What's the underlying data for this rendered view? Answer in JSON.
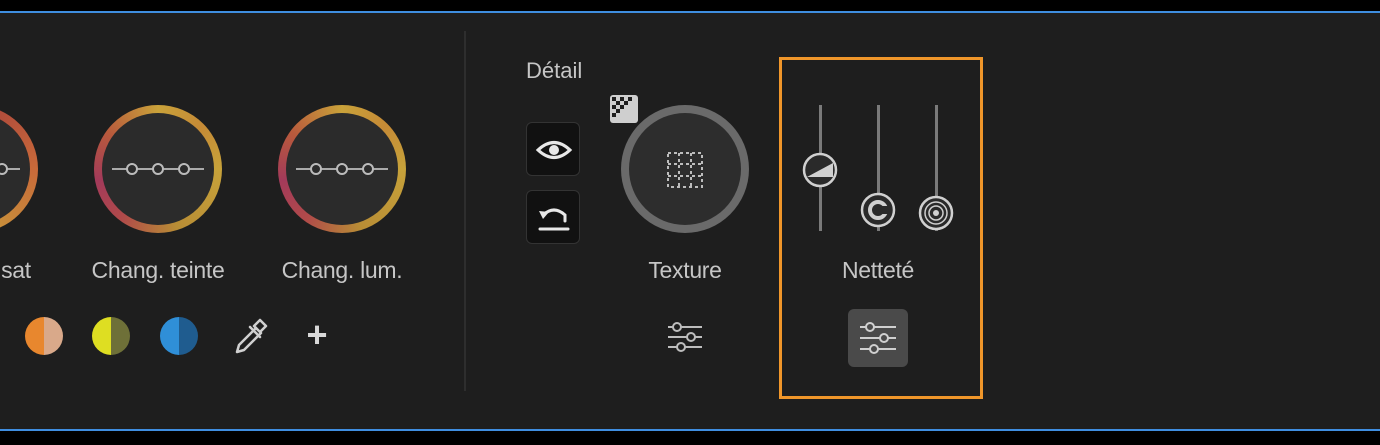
{
  "colors": {
    "accent_border": "#3f8ee0",
    "highlight": "#f0962a",
    "panel_bg": "#1e1e1e"
  },
  "color_section": {
    "wheels": [
      {
        "label": "sat",
        "icon": "saturation-wheel-icon"
      },
      {
        "label": "Chang. teinte",
        "icon": "hue-shift-wheel-icon"
      },
      {
        "label": "Chang. lum.",
        "icon": "luminance-shift-wheel-icon"
      }
    ],
    "swatches": [
      {
        "name": "orange",
        "left": "#e8872e",
        "right": "#d9a98a"
      },
      {
        "name": "yellow",
        "left": "#dede22",
        "right": "#6e7038"
      },
      {
        "name": "blue",
        "left": "#2f8fd8",
        "right": "#1f5c8f"
      }
    ],
    "eyedropper_icon": "eyedropper-icon",
    "add_label": "+"
  },
  "detail_section": {
    "title": "Détail",
    "visibility_icon": "eye-icon",
    "reset_icon": "reset-icon",
    "texture": {
      "label": "Texture",
      "badge_icon": "gradient-badge-icon",
      "settings_icon": "sliders-icon"
    },
    "sharpness": {
      "label": "Netteté",
      "settings_icon": "sliders-icon"
    }
  }
}
